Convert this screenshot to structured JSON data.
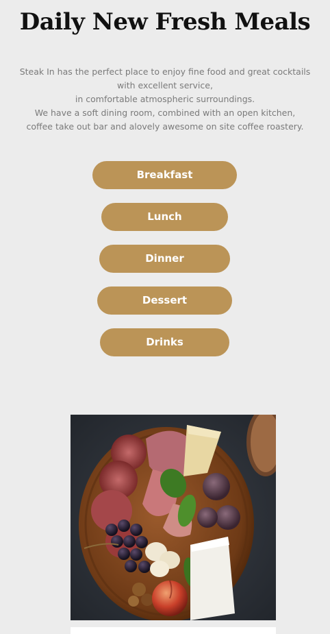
{
  "page": {
    "title": "Daily New Fresh Meals",
    "intro": {
      "line1": "Steak In has the perfect place to enjoy fine food and great cocktails with excellent service,",
      "line2": "in comfortable atmospheric surroundings.",
      "line3": "We have a soft dining room, combined with an open kitchen,",
      "line4": "coffee take out bar and alovely awesome on site coffee roastery."
    }
  },
  "menu": {
    "breakfast": "Breakfast",
    "lunch": "Lunch",
    "dinner": "Dinner",
    "dessert": "Dessert",
    "drinks": "Drinks"
  },
  "colors": {
    "background": "#ececec",
    "button": "#bb9457",
    "button_text": "#ffffff",
    "title": "#111111",
    "body_text": "#7a7a7a"
  }
}
